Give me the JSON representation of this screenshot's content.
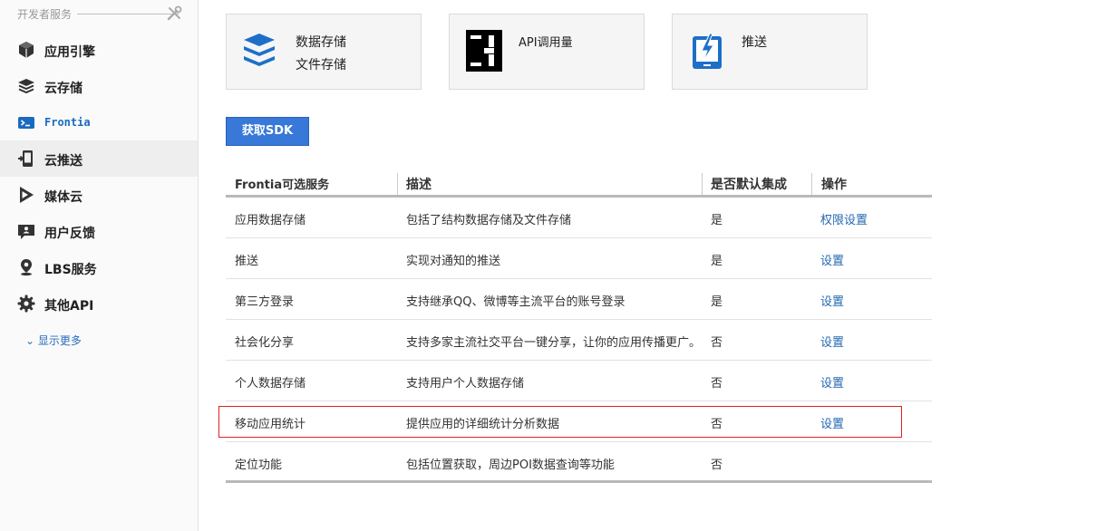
{
  "sidebar": {
    "header_title": "开发者服务",
    "items": [
      {
        "label": "应用引擎",
        "icon": "cube-icon"
      },
      {
        "label": "云存储",
        "icon": "layers-icon"
      },
      {
        "label": "Frontia",
        "icon": "terminal-icon"
      },
      {
        "label": "云推送",
        "icon": "phone-push-icon"
      },
      {
        "label": "媒体云",
        "icon": "play-icon"
      },
      {
        "label": "用户反馈",
        "icon": "feedback-icon"
      },
      {
        "label": "LBS服务",
        "icon": "location-pin-icon"
      },
      {
        "label": "其他API",
        "icon": "gear-icon"
      }
    ],
    "active_index": 3,
    "more_label": "显示更多"
  },
  "cards": [
    {
      "lines": [
        "数据存储",
        "文件存储"
      ],
      "icon": "stack-icon"
    },
    {
      "lines": [
        "API调用量"
      ],
      "icon": "api-bracket-icon"
    },
    {
      "lines": [
        "推送"
      ],
      "icon": "push-phone-icon"
    }
  ],
  "sdk_button": "获取SDK",
  "table": {
    "headers": [
      "Frontia可选服务",
      "描述",
      "是否默认集成",
      "操作"
    ],
    "rows": [
      {
        "name": "应用数据存储",
        "desc": "包括了结构数据存储及文件存储",
        "default": "是",
        "action": "权限设置"
      },
      {
        "name": "推送",
        "desc": "实现对通知的推送",
        "default": "是",
        "action": "设置"
      },
      {
        "name": "第三方登录",
        "desc": "支持继承QQ、微博等主流平台的账号登录",
        "default": "是",
        "action": "设置"
      },
      {
        "name": "社会化分享",
        "desc": "支持多家主流社交平台一键分享，让你的应用传播更广。",
        "default": "否",
        "action": "设置"
      },
      {
        "name": "个人数据存储",
        "desc": "支持用户个人数据存储",
        "default": "否",
        "action": "设置"
      },
      {
        "name": "移动应用统计",
        "desc": "提供应用的详细统计分析数据",
        "default": "否",
        "action": "设置"
      },
      {
        "name": "定位功能",
        "desc": "包括位置获取，周边POI数据查询等功能",
        "default": "否",
        "action": ""
      }
    ]
  },
  "colors": {
    "accent": "#3778d8",
    "link": "#2468b2",
    "highlight_border": "#dd2222"
  }
}
